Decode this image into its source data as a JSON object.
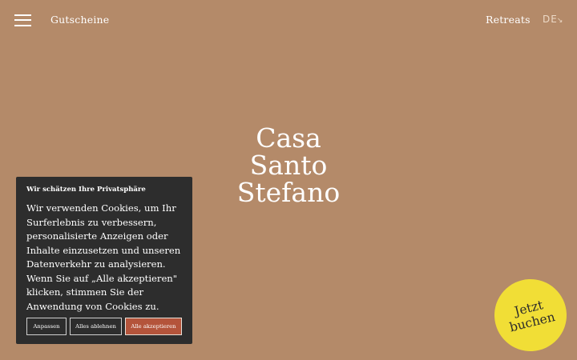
{
  "header": {
    "vouchers": "Gutscheine",
    "retreats": "Retreats",
    "language": "DE",
    "language_arrow": "↘"
  },
  "hero": {
    "title_lines": [
      "Casa",
      "Santo",
      "Stefano"
    ]
  },
  "cookie_banner": {
    "heading": "Wir schätzen Ihre Privatsphäre",
    "text": "Wir verwenden Cookies, um Ihr Surferlebnis zu verbessern, personalisierte Anzeigen oder Inhalte einzusetzen und unseren Datenverkehr zu analysieren. Wenn Sie auf „Alle akzeptieren\" klicken, stimmen Sie der Anwendung von Cookies zu.",
    "customize": "Anpassen",
    "reject": "Alles ablehnen",
    "accept": "Alle akzeptieren"
  },
  "book_now": {
    "line1": "Jetzt",
    "line2": "buchen"
  },
  "colors": {
    "background": "#b48a69",
    "banner": "#2d2d2d",
    "accept": "#b4543b",
    "badge": "#f1de36"
  },
  "icons": {
    "menu": "hamburger-icon"
  }
}
